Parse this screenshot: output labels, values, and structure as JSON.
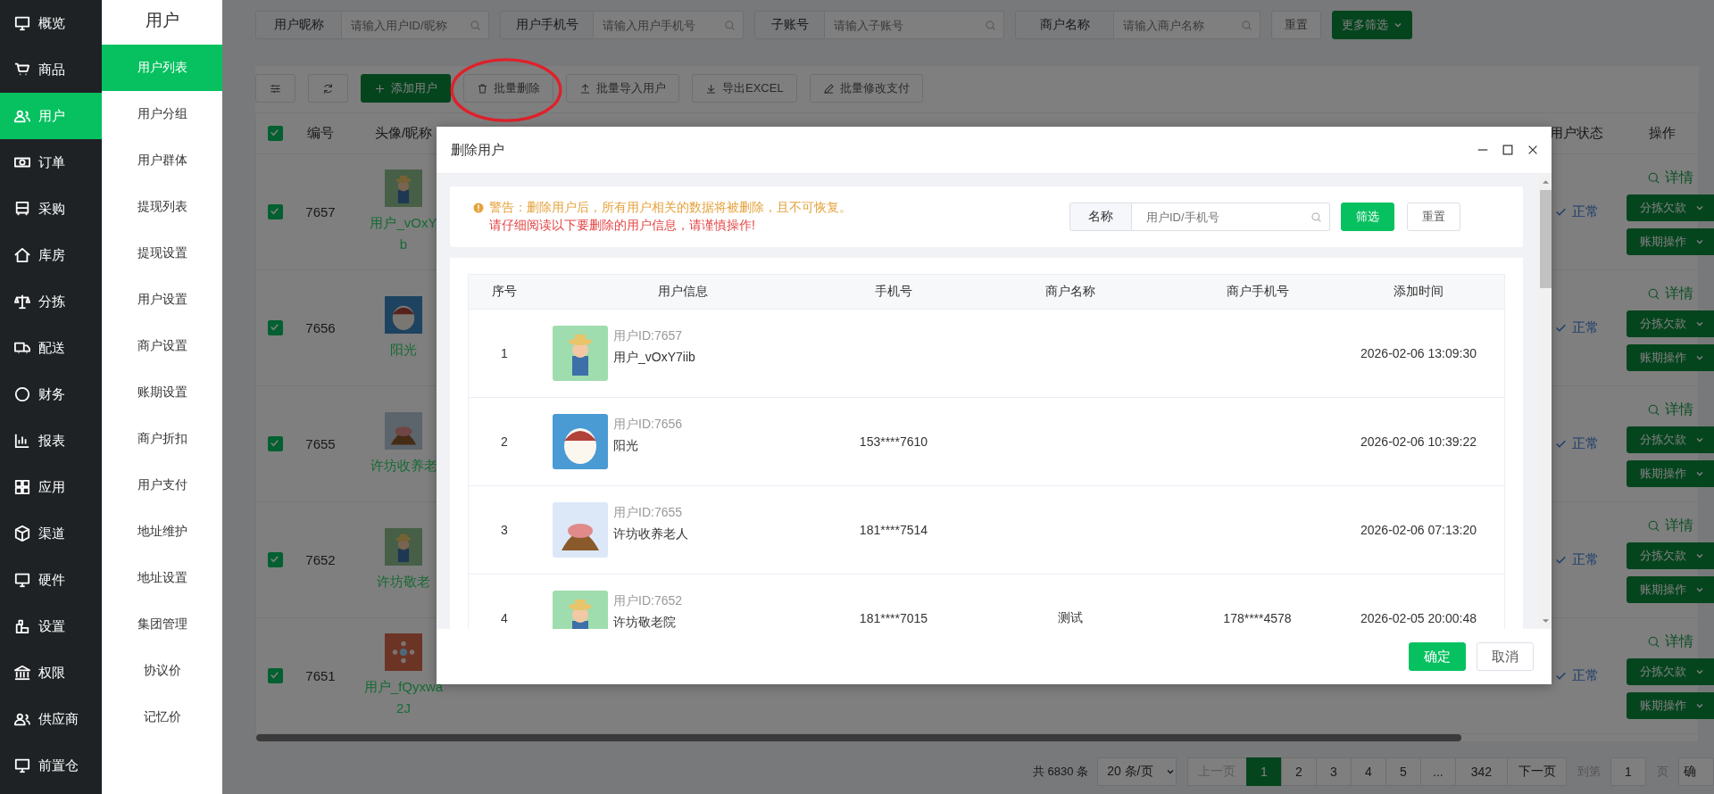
{
  "nav": {
    "items": [
      {
        "label": "概览",
        "selected": false
      },
      {
        "label": "商品",
        "selected": false
      },
      {
        "label": "用户",
        "selected": true
      },
      {
        "label": "订单",
        "selected": false
      },
      {
        "label": "采购",
        "selected": false
      },
      {
        "label": "库房",
        "selected": false
      },
      {
        "label": "分拣",
        "selected": false
      },
      {
        "label": "配送",
        "selected": false
      },
      {
        "label": "财务",
        "selected": false
      },
      {
        "label": "报表",
        "selected": false
      },
      {
        "label": "应用",
        "selected": false
      },
      {
        "label": "渠道",
        "selected": false
      },
      {
        "label": "硬件",
        "selected": false
      },
      {
        "label": "设置",
        "selected": false
      },
      {
        "label": "权限",
        "selected": false
      },
      {
        "label": "供应商",
        "selected": false
      },
      {
        "label": "前置仓",
        "selected": false
      }
    ]
  },
  "subnav": {
    "title": "用户",
    "items": [
      {
        "label": "用户列表",
        "selected": true
      },
      {
        "label": "用户分组",
        "selected": false
      },
      {
        "label": "用户群体",
        "selected": false
      },
      {
        "label": "提现列表",
        "selected": false
      },
      {
        "label": "提现设置",
        "selected": false
      },
      {
        "label": "用户设置",
        "selected": false
      },
      {
        "label": "商户设置",
        "selected": false
      },
      {
        "label": "账期设置",
        "selected": false
      },
      {
        "label": "商户折扣",
        "selected": false
      },
      {
        "label": "用户支付",
        "selected": false
      },
      {
        "label": "地址维护",
        "selected": false
      },
      {
        "label": "地址设置",
        "selected": false
      },
      {
        "label": "集团管理",
        "selected": false
      },
      {
        "label": "协议价",
        "selected": false
      },
      {
        "label": "记忆价",
        "selected": false
      }
    ]
  },
  "filters": [
    {
      "label": "用户昵称",
      "placeholder": "请输入用户ID/昵称"
    },
    {
      "label": "用户手机号",
      "placeholder": "请输入用户手机号"
    },
    {
      "label": "子账号",
      "placeholder": "请输入子账号"
    },
    {
      "label": "商户名称",
      "placeholder": "请输入商户名称"
    }
  ],
  "filter_reset": "重置",
  "more_filters": "更多筛选",
  "toolbar": [
    {
      "kind": "icon",
      "circled": false
    },
    {
      "kind": "icon",
      "circled": false
    },
    {
      "kind": "primary",
      "label": "添加用户",
      "circled": false
    },
    {
      "kind": "default",
      "label": "批量删除",
      "circled": true
    },
    {
      "kind": "default",
      "label": "批量导入用户",
      "circled": false
    },
    {
      "kind": "default",
      "label": "导出EXCEL",
      "circled": false
    },
    {
      "kind": "default",
      "label": "批量修改支付",
      "circled": false
    }
  ],
  "table": {
    "header_checked": true,
    "columns": [
      "编号",
      "头像/昵称",
      "用户状态",
      "操作"
    ],
    "rows": [
      {
        "checked": true,
        "id": "7657",
        "nickname": [
          "用户_vOxY",
          "b"
        ],
        "status": "正常",
        "detail": "详情",
        "actions": [
          "分拣欠款",
          "账期操作"
        ]
      },
      {
        "checked": true,
        "id": "7656",
        "nickname": [
          "阳光"
        ],
        "status": "正常",
        "detail": "详情",
        "actions": [
          "分拣欠款",
          "账期操作"
        ]
      },
      {
        "checked": true,
        "id": "7655",
        "nickname": [
          "许坊收养老"
        ],
        "status": "正常",
        "detail": "详情",
        "actions": [
          "分拣欠款",
          "账期操作"
        ]
      },
      {
        "checked": true,
        "id": "7652",
        "nickname": [
          "许坊敬老"
        ],
        "status": "正常",
        "detail": "详情",
        "actions": [
          "分拣欠款",
          "账期操作"
        ]
      },
      {
        "checked": true,
        "id": "7651",
        "nickname": [
          "用户_fQyxwa",
          "2J"
        ],
        "status": "正常",
        "detail": "详情",
        "actions": [
          "分拣欠款",
          "账期操作"
        ]
      }
    ]
  },
  "pagination": {
    "total": "共 6830 条",
    "page_size": "20 条/页",
    "prev": "上一页",
    "pages": [
      {
        "label": "1",
        "selected": true
      },
      {
        "label": "2",
        "selected": false
      },
      {
        "label": "3",
        "selected": false
      },
      {
        "label": "4",
        "selected": false
      },
      {
        "label": "5",
        "selected": false
      },
      {
        "label": "...",
        "selected": false
      },
      {
        "label": "342",
        "selected": false
      }
    ],
    "next": "下一页",
    "goto_label": "到第",
    "goto_value": "1",
    "goto_unit": "页",
    "confirm": "确"
  },
  "modal": {
    "title": "删除用户",
    "warning": "警告：删除用户后，所有用户相关的数据将被删除，且不可恢复。",
    "instruction": "请仔细阅读以下要删除的用户信息，请谨慎操作!",
    "search_label": "名称",
    "search_placeholder": "用户ID/手机号",
    "filter_button": "筛选",
    "reset_button": "重置",
    "columns": [
      "序号",
      "用户信息",
      "手机号",
      "商户名称",
      "商户手机号",
      "添加时间"
    ],
    "rows": [
      {
        "index": "1",
        "user_id": "用户ID:7657",
        "name": "用户_vOxY7iib",
        "added": "2026-02-06 13:09:30"
      },
      {
        "index": "2",
        "user_id": "用户ID:7656",
        "name": "阳光",
        "phone": "153****7610",
        "added": "2026-02-06 10:39:22"
      },
      {
        "index": "3",
        "user_id": "用户ID:7655",
        "name": "许坊收养老人",
        "phone": "181****7514",
        "added": "2026-02-06 07:13:20"
      },
      {
        "index": "4",
        "user_id": "用户ID:7652",
        "name": "许坊敬老院",
        "phone": "181****7015",
        "merchant": "测试",
        "merchant_phone": "178****4578",
        "added": "2026-02-05 20:00:48"
      }
    ],
    "confirm": "确定",
    "cancel": "取消"
  }
}
